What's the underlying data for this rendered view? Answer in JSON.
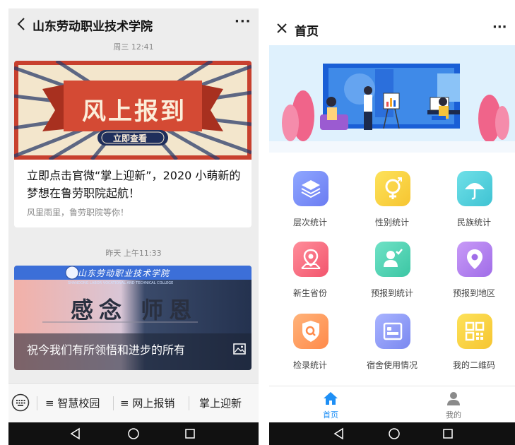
{
  "left_phone": {
    "header": {
      "title": "山东劳动职业技术学院",
      "more": "···"
    },
    "messages": [
      {
        "time": "周三 12:41",
        "banner_text": "风上报到",
        "banner_button": "立即查看",
        "title": "立即点击官微“掌上迎新”，2020 小萌新的梦想在鲁劳职院起航！",
        "subtitle": "风里雨里，鲁劳职院等你！"
      },
      {
        "time": "昨天 上午11:33",
        "banner_header": "山东劳动职业技术学院",
        "banner_header_en": "SHANDONG LABOR VOCATIONAL AND TECHNICAL COLLEGE",
        "banner_title": "感念 师恩",
        "caption": "祝今我们有所领悟和进步的所有"
      }
    ],
    "bottom_menu": [
      "≡ 智慧校园",
      "≡ 网上报销",
      "掌上迎新"
    ]
  },
  "right_phone": {
    "header": {
      "title": "首页",
      "more": "···"
    },
    "grid": [
      {
        "label": "层次统计",
        "icon": "layers-icon",
        "color_from": "#8fa7ff",
        "color_to": "#6b7cf2"
      },
      {
        "label": "性别统计",
        "icon": "gender-icon",
        "color_from": "#fde25a",
        "color_to": "#f6c531"
      },
      {
        "label": "民族统计",
        "icon": "umbrella-icon",
        "color_from": "#6fe0e8",
        "color_to": "#3fc3d3"
      },
      {
        "label": "新生省份",
        "icon": "map-pin-icon",
        "color_from": "#ff8d9a",
        "color_to": "#f2556d"
      },
      {
        "label": "预报到统计",
        "icon": "user-check-icon",
        "color_from": "#6fe2c6",
        "color_to": "#3cc6a4"
      },
      {
        "label": "预报到地区",
        "icon": "location-icon",
        "color_from": "#c89af7",
        "color_to": "#a06de8"
      },
      {
        "label": "检录统计",
        "icon": "search-shield-icon",
        "color_from": "#ffb37a",
        "color_to": "#ff8a4a"
      },
      {
        "label": "宿舍使用情况",
        "icon": "bed-icon",
        "color_from": "#a9b4ff",
        "color_to": "#7a88f0"
      },
      {
        "label": "我的二维码",
        "icon": "qrcode-icon",
        "color_from": "#fde25a",
        "color_to": "#f6c531"
      }
    ],
    "tabs": [
      {
        "label": "首页",
        "icon": "home-icon",
        "color": "#1e8ff5"
      },
      {
        "label": "我的",
        "icon": "user-icon",
        "color": "#8a8a8a"
      }
    ]
  },
  "colors": {
    "accent_blue": "#1e8ff5",
    "banner_red": "#c8402e",
    "navbar": "#111111"
  }
}
